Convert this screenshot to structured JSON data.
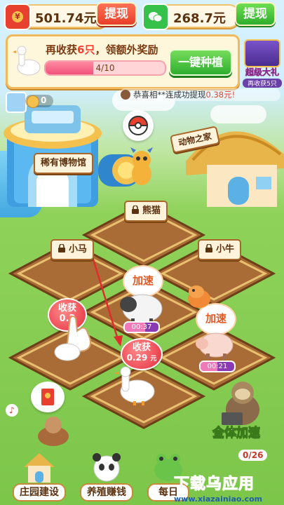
{
  "wallet": {
    "red_envelope_amount": "501.74元",
    "red_envelope_withdraw": "提现",
    "wechat_amount": "268.7元",
    "wechat_withdraw": "提现",
    "yuan_symbol": "¥"
  },
  "task": {
    "text_prefix": "再收获",
    "text_count": "6只",
    "text_suffix": "，领额外奖励",
    "progress_label": "4/10",
    "progress_value": 0.4,
    "plant_button": "一键种植"
  },
  "super_gift": {
    "title": "超级大礼",
    "subtitle": "再收获5只"
  },
  "player": {
    "coins": "0"
  },
  "ticker": {
    "message": "恭喜相**连成功提现",
    "amount": "0.38元!"
  },
  "buildings": {
    "museum": "稀有博物馆",
    "animal_house": "动物之家"
  },
  "plots": {
    "panda_sign": "熊猫",
    "horse_sign": "小马",
    "cattle_sign": "小牛"
  },
  "animals": {
    "harvest_bubble_1": "收获",
    "harvest_value_1": "0.2",
    "harvest_bubble_2": "收获",
    "harvest_value_2": "0.29",
    "harvest_unit": "元",
    "speedup_1": "加速",
    "speedup_2": "加速",
    "sheep_timer": "00:37",
    "sheep_progress": 0.6,
    "pig_timer": "00:21",
    "pig_progress": 0.5
  },
  "all_speedup": "全体加速",
  "counter": "0/26",
  "bottom_nav": [
    {
      "label": "庄园建设",
      "icon": "house-icon"
    },
    {
      "label": "养殖赚钱",
      "icon": "panda-icon"
    },
    {
      "label": "每日",
      "icon": "frog-icon"
    }
  ],
  "watermark": "下载乌应用",
  "watermark_url": "www.xiazainiao.com",
  "colors": {
    "red": "#e83e2a",
    "green": "#2fae2d",
    "brown": "#5b3210"
  }
}
